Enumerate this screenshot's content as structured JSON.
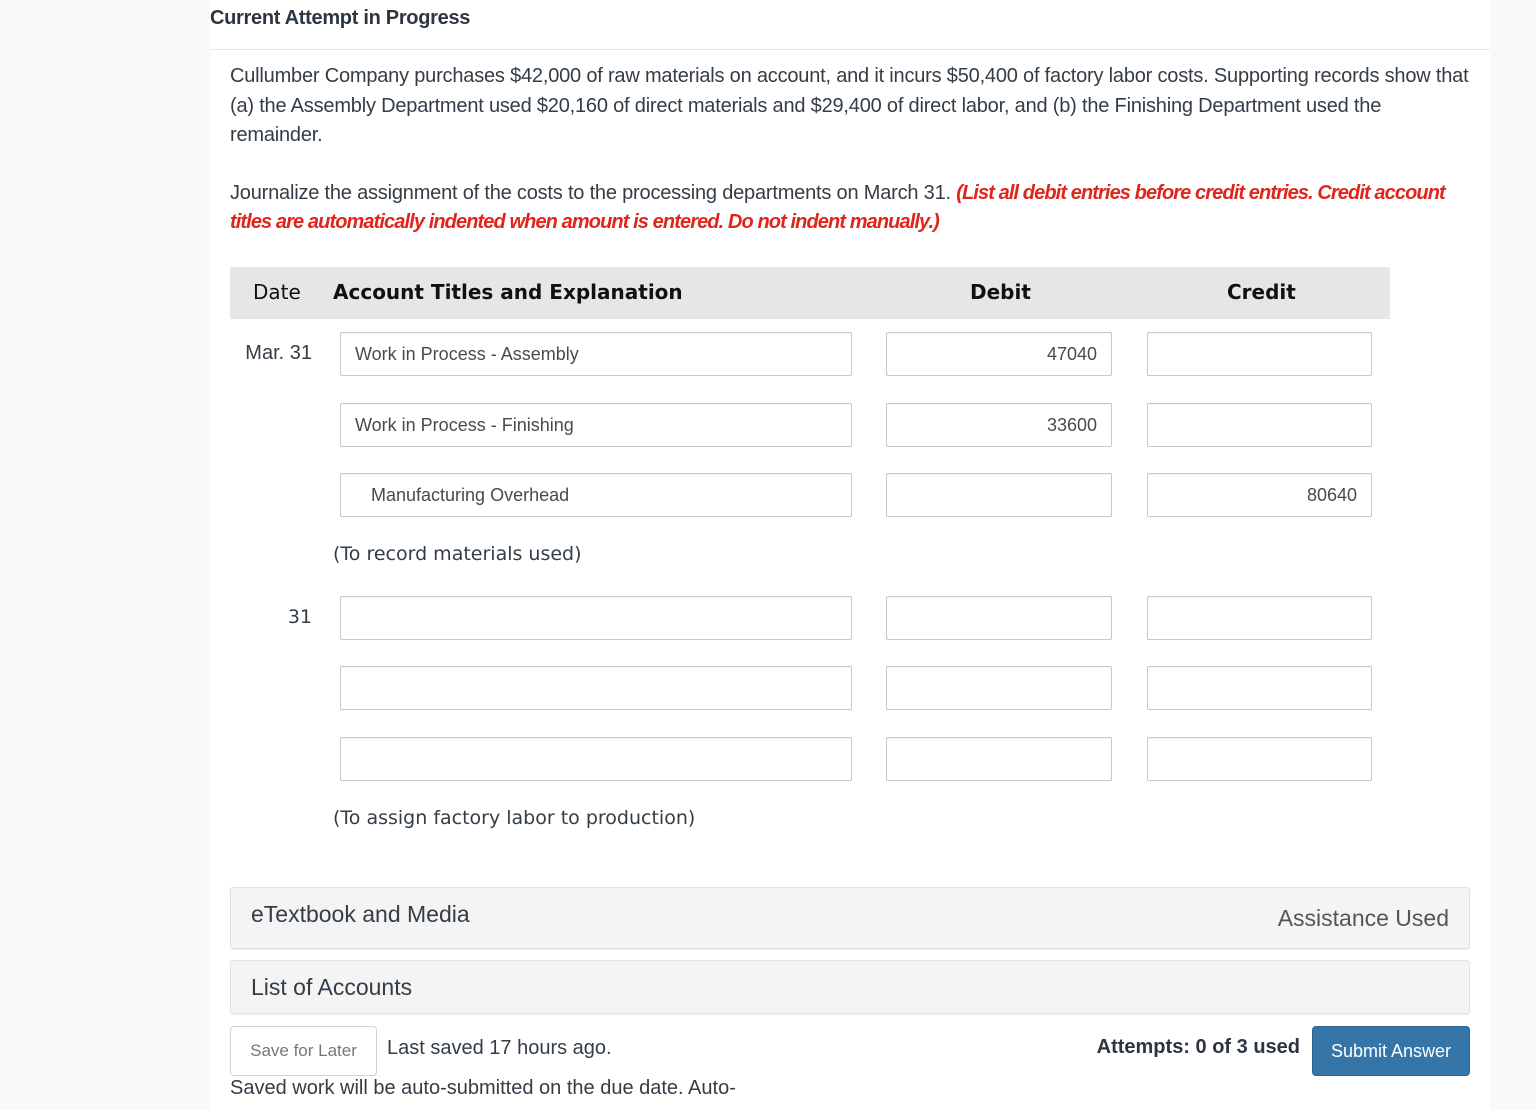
{
  "header": {
    "title": "Current Attempt in Progress"
  },
  "question": {
    "text": "Cullumber Company purchases $42,000 of raw materials on account, and it incurs $50,400 of factory labor costs. Supporting records show that (a) the Assembly Department used $20,160 of direct materials and $29,400 of direct labor, and (b) the Finishing Department used the remainder.",
    "instruction": "Journalize the assignment of the costs to the processing departments on March 31. ",
    "warning": "(List all debit entries before credit entries. Credit account titles are automatically indented when amount is entered. Do not indent manually.)"
  },
  "table": {
    "headers": {
      "date": "Date",
      "account": "Account Titles and Explanation",
      "debit": "Debit",
      "credit": "Credit"
    },
    "entries": [
      {
        "date": "Mar. 31",
        "rows": [
          {
            "account": "Work in Process - Assembly",
            "debit": "47040",
            "credit": ""
          },
          {
            "account": "Work in Process - Finishing",
            "debit": "33600",
            "credit": ""
          },
          {
            "account": "Manufacturing Overhead",
            "debit": "",
            "credit": "80640"
          }
        ],
        "explanation": "(To record materials used)"
      },
      {
        "date": "31",
        "rows": [
          {
            "account": "",
            "debit": "",
            "credit": ""
          },
          {
            "account": "",
            "debit": "",
            "credit": ""
          },
          {
            "account": "",
            "debit": "",
            "credit": ""
          }
        ],
        "explanation": "(To assign factory labor to production)"
      }
    ]
  },
  "accordions": {
    "etextbook": "eTextbook and Media",
    "assistance": "Assistance Used",
    "accounts": "List of Accounts"
  },
  "footer": {
    "save_label": "Save for Later",
    "last_saved": "Last saved 17 hours ago.",
    "auto_note": "Saved work will be auto-submitted on the due date. Auto-",
    "attempts": "Attempts: 0 of 3 used",
    "submit_label": "Submit Answer"
  },
  "colors": {
    "warning": "#e0251b",
    "submit": "#3575a8"
  }
}
